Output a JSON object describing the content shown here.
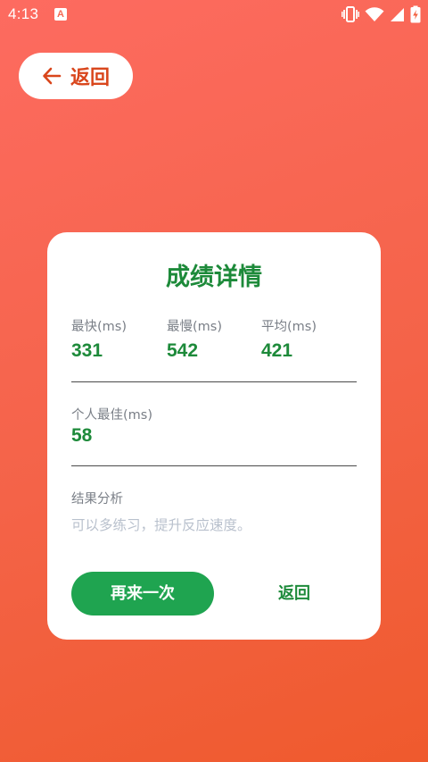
{
  "status_bar": {
    "time": "4:13",
    "notification_icon": "a-badge-icon"
  },
  "top": {
    "back_label": "返回"
  },
  "card": {
    "title": "成绩详情",
    "stats": [
      {
        "label": "最快(ms)",
        "value": "331"
      },
      {
        "label": "最慢(ms)",
        "value": "542"
      },
      {
        "label": "平均(ms)",
        "value": "421"
      }
    ],
    "best": {
      "label": "个人最佳(ms)",
      "value": "58"
    },
    "analysis": {
      "heading": "结果分析",
      "text": "可以多练习，提升反应速度。"
    },
    "retry_label": "再来一次",
    "return_label": "返回"
  },
  "colors": {
    "accent_green": "#1d8a3a",
    "button_green": "#1fa450",
    "back_orange": "#d9461c",
    "bg_top": "#fd6b60",
    "bg_bottom": "#ef5a2d"
  }
}
